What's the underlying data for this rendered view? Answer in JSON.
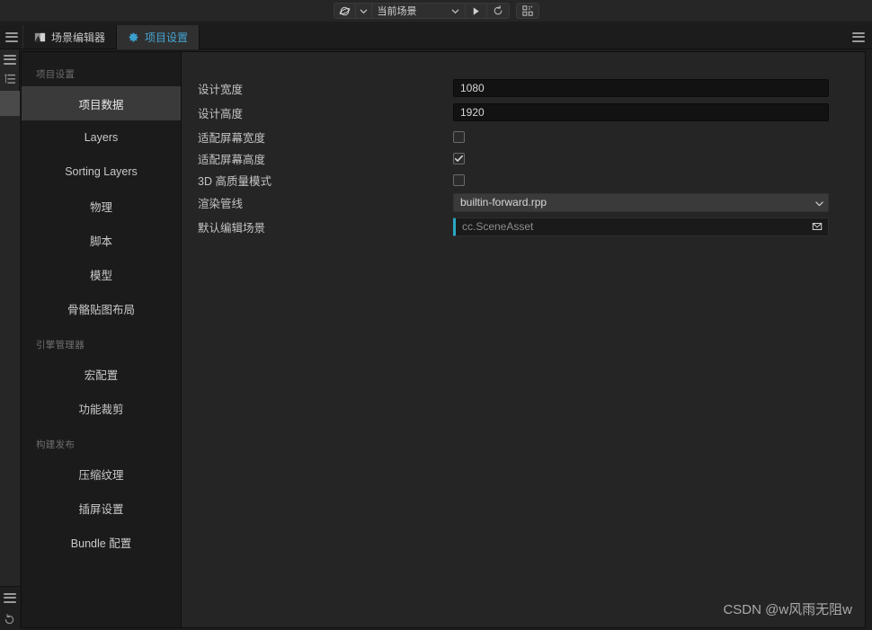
{
  "topbar": {
    "preview_target_icon": "globe-icon",
    "preview_target_chevron": "chevron-down-icon",
    "scene_select_value": "当前场景",
    "scene_select_chevron": "chevron-down-icon",
    "play_label": "play-icon",
    "refresh_label": "refresh-icon",
    "device_preview_label": "qr-code-icon"
  },
  "tabbar": {
    "left_menu": "hamburger-icon",
    "right_menu": "hamburger-icon",
    "tabs": [
      {
        "label": "场景编辑器",
        "icon": "image-icon",
        "active": false
      },
      {
        "label": "项目设置",
        "icon": "gear-icon",
        "active": true
      }
    ]
  },
  "rail": {
    "top_icons": [
      "hamburger-icon",
      "hierarchy-icon"
    ],
    "bottom_icons": [
      "hamburger-icon",
      "refresh-icon"
    ]
  },
  "sidebar": {
    "groups": [
      {
        "title": "项目设置",
        "items": [
          {
            "label": "项目数据",
            "active": true
          },
          {
            "label": "Layers",
            "active": false
          },
          {
            "label": "Sorting Layers",
            "active": false
          },
          {
            "label": "物理",
            "active": false
          },
          {
            "label": "脚本",
            "active": false
          },
          {
            "label": "模型",
            "active": false
          },
          {
            "label": "骨骼贴图布局",
            "active": false
          }
        ]
      },
      {
        "title": "引擎管理器",
        "items": [
          {
            "label": "宏配置",
            "active": false
          },
          {
            "label": "功能裁剪",
            "active": false
          }
        ]
      },
      {
        "title": "构建发布",
        "items": [
          {
            "label": "压缩纹理",
            "active": false
          },
          {
            "label": "插屏设置",
            "active": false
          },
          {
            "label": "Bundle 配置",
            "active": false
          }
        ]
      }
    ]
  },
  "form": {
    "rows": [
      {
        "label": "设计宽度",
        "type": "text",
        "value": "1080"
      },
      {
        "label": "设计高度",
        "type": "text",
        "value": "1920"
      },
      {
        "label": "适配屏幕宽度",
        "type": "checkbox",
        "checked": false
      },
      {
        "label": "适配屏幕高度",
        "type": "checkbox",
        "checked": true
      },
      {
        "label": "3D 高质量模式",
        "type": "checkbox",
        "checked": false
      },
      {
        "label": "渲染管线",
        "type": "select",
        "value": "builtin-forward.rpp"
      },
      {
        "label": "默认编辑场景",
        "type": "asset",
        "value": "cc.SceneAsset"
      }
    ]
  },
  "watermark": {
    "text": "CSDN @w风雨无阻w"
  },
  "colors": {
    "accent": "#45a6d4",
    "asset_marker": "#2aa7c4",
    "panel_bg": "#252525",
    "sidebar_bg": "#1b1b1b",
    "active_item_bg": "#3a3a3a"
  }
}
